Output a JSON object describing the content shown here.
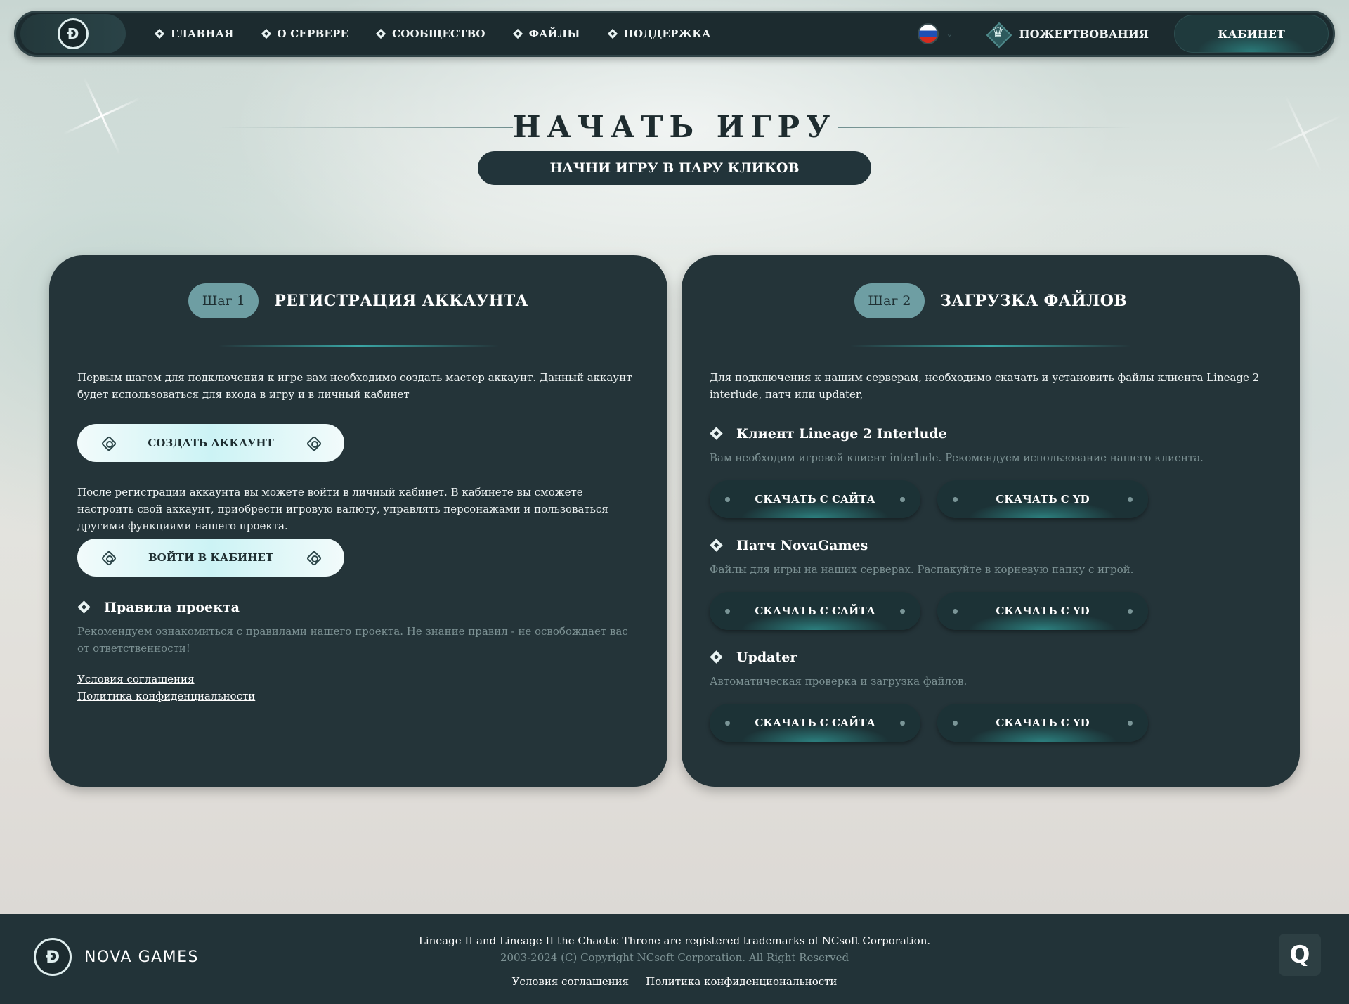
{
  "nav": {
    "logo_letter": "Đ",
    "items": [
      {
        "label": "ГЛАВНАЯ"
      },
      {
        "label": "О СЕРВЕРЕ"
      },
      {
        "label": "СООБЩЕСТВО"
      },
      {
        "label": "ФАЙЛЫ"
      },
      {
        "label": "ПОДДЕРЖКА"
      }
    ],
    "language_chevron": "⌄",
    "donate_label": "ПОЖЕРТВОВАНИЯ",
    "cabinet_label": "КАБИНЕТ"
  },
  "hero": {
    "title": "НАЧАТЬ ИГРУ",
    "subtitle": "НАЧНИ ИГРУ В ПАРУ КЛИКОВ"
  },
  "step1": {
    "pill": "Шаг 1",
    "title": "РЕГИСТРАЦИЯ АККАУНТА",
    "intro": "Первым шагом для подключения к игре вам необходимо создать мастер аккаунт. Данный аккаунт будет использоваться для входа в игру и в личный кабинет",
    "create_btn": "СОЗДАТЬ АККАУНТ",
    "after_text": "После регистрации аккаунта вы можете войти в личный кабинет. В кабинете вы сможете настроить свой аккаунт, приобрести игровую валюту, управлять персонажами и пользоваться другими функциями нашего проекта.",
    "login_btn": "ВОЙТИ В КАБИНЕТ",
    "rules_title": "Правила проекта",
    "rules_text": "Рекомендуем ознакомиться с правилами нашего проекта. Не знание правил - не освобождает вас от ответственности!",
    "link_terms": "Условия соглашения",
    "link_privacy": "Политика конфиденциальности"
  },
  "step2": {
    "pill": "Шаг 2",
    "title": "ЗАГРУЗКА ФАЙЛОВ",
    "intro": "Для подключения к нашим серверам, необходимо скачать и установить файлы клиента Lineage 2 interlude, патч или updater,",
    "sections": [
      {
        "title": "Клиент Lineage 2 Interlude",
        "desc": "Вам необходим игровой клиент interlude. Рекомендуем использование нашего клиента.",
        "btn_site": "СКАЧАТЬ С САЙТА",
        "btn_yd": "СКАЧАТЬ С YD"
      },
      {
        "title": "Патч NovaGames",
        "desc": "Файлы для игры на наших серверах. Распакуйте в корневую папку с игрой.",
        "btn_site": "СКАЧАТЬ С САЙТА",
        "btn_yd": "СКАЧАТЬ С YD"
      },
      {
        "title": "Updater",
        "desc": "Автоматическая проверка и загрузка файлов.",
        "btn_site": "СКАЧАТЬ С САЙТА",
        "btn_yd": "СКАЧАТЬ С YD"
      }
    ]
  },
  "footer": {
    "logo_letter": "Đ",
    "brand": "NOVA GAMES",
    "trademark": "Lineage II and Lineage II the Chaotic Throne are registered trademarks of NCsoft Corporation.",
    "copyright": "2003-2024 (C) Copyright NCsoft Corporation. All Right Reserved",
    "link_terms": "Условия соглашения",
    "link_privacy": "Политика конфиденциональности",
    "corner_icon_letter": "Q"
  },
  "colors": {
    "panel_bg": "#243439",
    "nav_bg": "#1c2b2f",
    "accent_teal": "#3aa7a6",
    "step_pill": "#6e9ea3"
  },
  "icons": {
    "nav_item": "diamond-gem-icon",
    "donate": "crown-icon",
    "language": "russia-flag-icon",
    "button_ornament": "knot-ornament-icon"
  }
}
